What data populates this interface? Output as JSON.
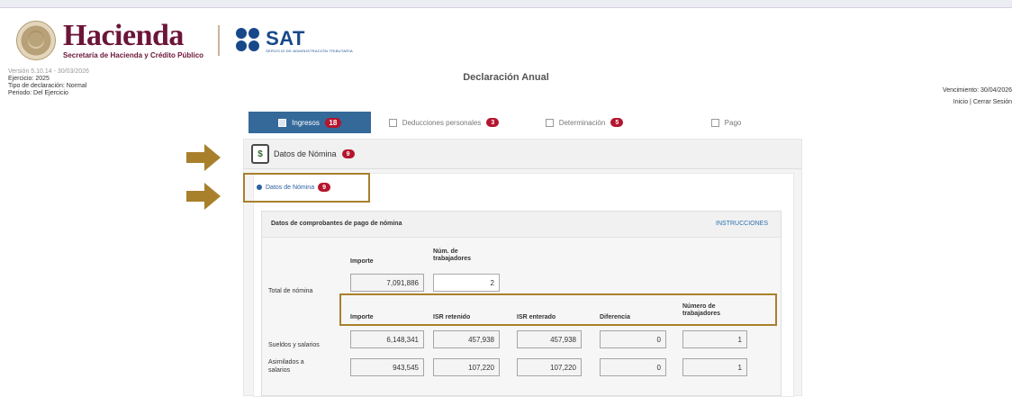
{
  "header": {
    "hacienda_title": "Hacienda",
    "hacienda_subtitle": "Secretaría de Hacienda y Crédito Público",
    "sat_title": "SAT",
    "sat_subtitle": "SERVICIO DE ADMINISTRACIÓN TRIBUTARIA"
  },
  "info": {
    "version": "Versión 5.10.14 - 30/03/2026",
    "ejercicio": "Ejercicio: 2025",
    "tipo": "Tipo de declaración: Normal",
    "periodo": "Periodo: Del Ejercicio"
  },
  "doc_title": "Declaración Anual",
  "due": {
    "vencimiento": "Vencimiento: 30/04/2026",
    "links": "Inicio | Cerrar Sesión"
  },
  "tabs": [
    {
      "label": "Ingresos",
      "badge": "18",
      "active": true
    },
    {
      "label": "Deducciones personales",
      "badge": "3"
    },
    {
      "label": "Determinación",
      "badge": "5"
    },
    {
      "label": "Pago"
    }
  ],
  "section": {
    "title": "Datos de Nómina",
    "badge": "9"
  },
  "subsection": {
    "title": "Datos de Nómina",
    "badge": "9"
  },
  "card": {
    "title": "Datos de comprobantes de pago de nómina",
    "instructions": "INSTRUCCIONES",
    "top_headers": {
      "importe": "Importe",
      "num_trab": "Núm. de trabajadores"
    },
    "total": {
      "label": "Total de nómina",
      "importe": "7,091,886",
      "trabajadores": "2"
    },
    "headers": {
      "importe": "Importe",
      "isr_retenido": "ISR retenido",
      "isr_enterado": "ISR enterado",
      "diferencia": "Diferencia",
      "num_trab": "Número de trabajadores"
    },
    "rows": [
      {
        "label": "Sueldos y salarios",
        "importe": "6,148,341",
        "isr_retenido": "457,938",
        "isr_enterado": "457,938",
        "diferencia": "0",
        "trabajadores": "1"
      },
      {
        "label": "Asimilados a salarios",
        "importe": "943,545",
        "isr_retenido": "107,220",
        "isr_enterado": "107,220",
        "diferencia": "0",
        "trabajadores": "1"
      }
    ]
  },
  "colors": {
    "tab_active": "#34699a",
    "badge": "#b4152d",
    "link": "#2a5fa0",
    "annotation": "#a8802c"
  }
}
